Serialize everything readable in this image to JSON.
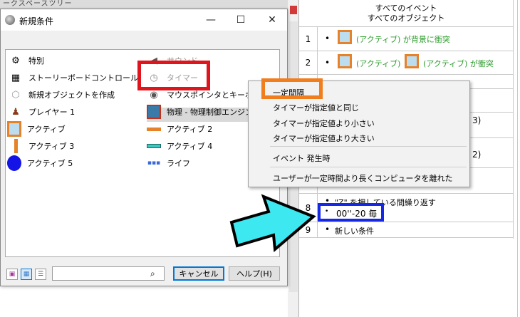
{
  "background": {
    "strip_text": "ークスペースツリー",
    "event_editor": {
      "header_line1": "すべてのイベント",
      "header_line2": "すべてのオブジェクト",
      "rows": [
        {
          "num": "1",
          "text": "(アクティブ) が背景に衝突"
        },
        {
          "num": "2",
          "text_a": "(アクティブ) と",
          "text_b": "(アクティブ) が衝突"
        },
        {
          "num": "8",
          "text": "\"Z\" を押している間繰り返す",
          "sub": "00''-20 毎"
        },
        {
          "num": "9",
          "text": "新しい条件"
        }
      ],
      "partial_text_1": "3)",
      "partial_text_2": "2)"
    }
  },
  "dialog": {
    "title": "新規条件",
    "minimize": "—",
    "maximize": "☐",
    "close": "✕",
    "left_items": [
      {
        "label": "特別",
        "icon": "gears-icon"
      },
      {
        "label": "ストーリーボードコントロール",
        "icon": "checkered-flag-icon"
      },
      {
        "label": "新規オブジェクトを作成",
        "icon": "new-object-icon"
      },
      {
        "label": "プレイヤー 1",
        "icon": "joystick-icon"
      },
      {
        "label": "アクティブ",
        "icon": "active-square-icon"
      },
      {
        "label": "アクティブ 3",
        "icon": "active-line-icon"
      },
      {
        "label": "アクティブ 5",
        "icon": "blue-circle-icon"
      }
    ],
    "right_items": [
      {
        "label": "サウンド",
        "icon": "speaker-icon"
      },
      {
        "label": "タイマー",
        "icon": "clock-icon"
      },
      {
        "label": "マウスポインタとキーボード",
        "icon": "mouse-icon"
      },
      {
        "label": "物理 - 物理制御エンジン",
        "icon": "physics-icon"
      },
      {
        "label": "アクティブ 2",
        "icon": "orange-bar-icon"
      },
      {
        "label": "アクティブ 4",
        "icon": "teal-bar-icon"
      },
      {
        "label": "ライフ",
        "icon": "life-icon"
      }
    ],
    "search_placeholder": "",
    "cancel_label": "キャンセル",
    "help_label": "ヘルプ(H)"
  },
  "context_menu": {
    "items": [
      "一定間隔",
      "タイマーが指定値と同じ",
      "タイマーが指定値より小さい",
      "タイマーが指定値より大きい",
      "イベント 発生時",
      "ユーザーが一定時間より長くコンピュータを離れた"
    ]
  },
  "colors": {
    "highlight_red": "#e0141c",
    "highlight_orange": "#f07d1e",
    "highlight_blue": "#1428e6",
    "arrow_fill": "#3ee8f0",
    "condition_green": "#2a9a2a"
  }
}
